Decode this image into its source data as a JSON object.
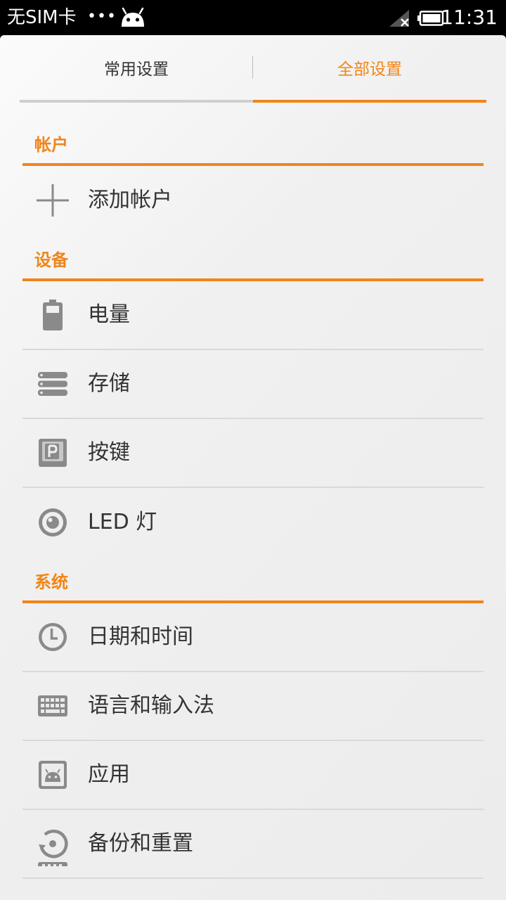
{
  "status_bar": {
    "carrier": "无SIM卡",
    "dots": "•••",
    "time": "11:31"
  },
  "tabs": [
    {
      "label": "常用设置",
      "active": false
    },
    {
      "label": "全部设置",
      "active": true
    }
  ],
  "sections": {
    "account": {
      "title": "帐户",
      "items": [
        {
          "label": "添加帐户",
          "icon": "plus-icon"
        }
      ]
    },
    "device": {
      "title": "设备",
      "items": [
        {
          "label": "电量",
          "icon": "battery-icon"
        },
        {
          "label": "存储",
          "icon": "storage-icon"
        },
        {
          "label": "按键",
          "icon": "keys-icon"
        },
        {
          "label": "LED 灯",
          "icon": "led-icon"
        }
      ]
    },
    "system": {
      "title": "系统",
      "items": [
        {
          "label": "日期和时间",
          "icon": "clock-icon"
        },
        {
          "label": "语言和输入法",
          "icon": "keyboard-icon"
        },
        {
          "label": "应用",
          "icon": "apps-icon"
        },
        {
          "label": "备份和重置",
          "icon": "backup-icon"
        }
      ]
    }
  },
  "colors": {
    "accent": "#f08519",
    "text": "#333333",
    "icon": "#8a8a8a",
    "divider": "#d9d9d9"
  }
}
